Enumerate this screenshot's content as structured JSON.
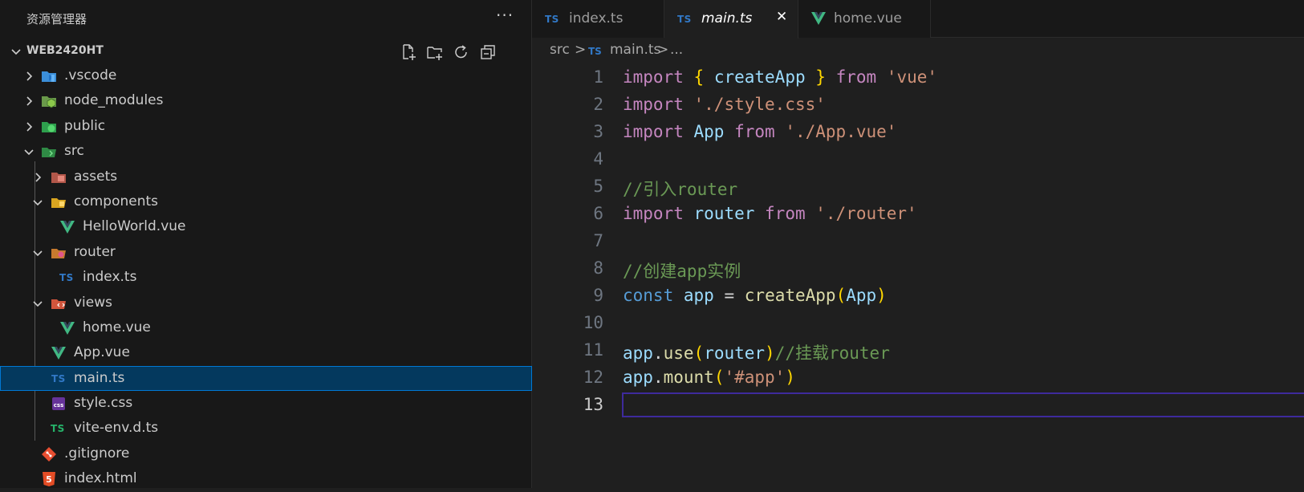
{
  "explorer": {
    "title": "资源管理器",
    "more": "···",
    "project": "WEB2420HT",
    "actions": [
      "new-file-icon",
      "new-folder-icon",
      "refresh-icon",
      "collapse-all-icon"
    ]
  },
  "tree": [
    {
      "label": ".vscode",
      "icon": "vscode-folder-icon",
      "expanded": false
    },
    {
      "label": "node_modules",
      "icon": "node-folder-icon",
      "expanded": false
    },
    {
      "label": "public",
      "icon": "public-folder-icon",
      "expanded": false
    },
    {
      "label": "src",
      "icon": "src-folder-icon",
      "expanded": true
    },
    {
      "label": "assets",
      "icon": "assets-folder-icon",
      "expanded": false
    },
    {
      "label": "components",
      "icon": "components-folder-icon",
      "expanded": true
    },
    {
      "label": "HelloWorld.vue",
      "icon": "vue-icon"
    },
    {
      "label": "router",
      "icon": "router-folder-icon",
      "expanded": true
    },
    {
      "label": "index.ts",
      "icon": "ts-icon",
      "badge": "TS"
    },
    {
      "label": "views",
      "icon": "views-folder-icon",
      "expanded": true
    },
    {
      "label": "home.vue",
      "icon": "vue-icon"
    },
    {
      "label": "App.vue",
      "icon": "vue-icon"
    },
    {
      "label": "main.ts",
      "icon": "ts-icon",
      "badge": "TS",
      "selected": true
    },
    {
      "label": "style.css",
      "icon": "css-icon",
      "badge": "css"
    },
    {
      "label": "vite-env.d.ts",
      "icon": "ts-icon",
      "badge": "TS"
    },
    {
      "label": ".gitignore",
      "icon": "git-icon"
    },
    {
      "label": "index.html",
      "icon": "html-icon",
      "badge": "5"
    }
  ],
  "tabs": [
    {
      "label": "index.ts",
      "badge": "TS",
      "active": false
    },
    {
      "label": "main.ts",
      "badge": "TS",
      "active": true,
      "close": "✕"
    },
    {
      "label": "home.vue",
      "badge": "V",
      "active": false
    }
  ],
  "breadcrumb": {
    "folder": "src",
    "sep": ">",
    "badge": "TS",
    "file": "main.ts",
    "sep2": ">",
    "rest": "..."
  },
  "code": {
    "lines": [
      "1",
      "2",
      "3",
      "4",
      "5",
      "6",
      "7",
      "8",
      "9",
      "10",
      "11",
      "12",
      "13"
    ],
    "current_line": "13",
    "comments": {
      "c1": "//引入router",
      "c2": "//创建app实例",
      "c3": "//挂载router"
    },
    "strings": {
      "vue": "'vue'",
      "style": "'./style.css'",
      "app": "'./App.vue'",
      "router": "'./router'",
      "mount": "'#app'"
    }
  },
  "colors": {
    "accent": "#0078d4",
    "selection": "#04395e",
    "ts": "#3178c6",
    "vue": "#41b883"
  }
}
